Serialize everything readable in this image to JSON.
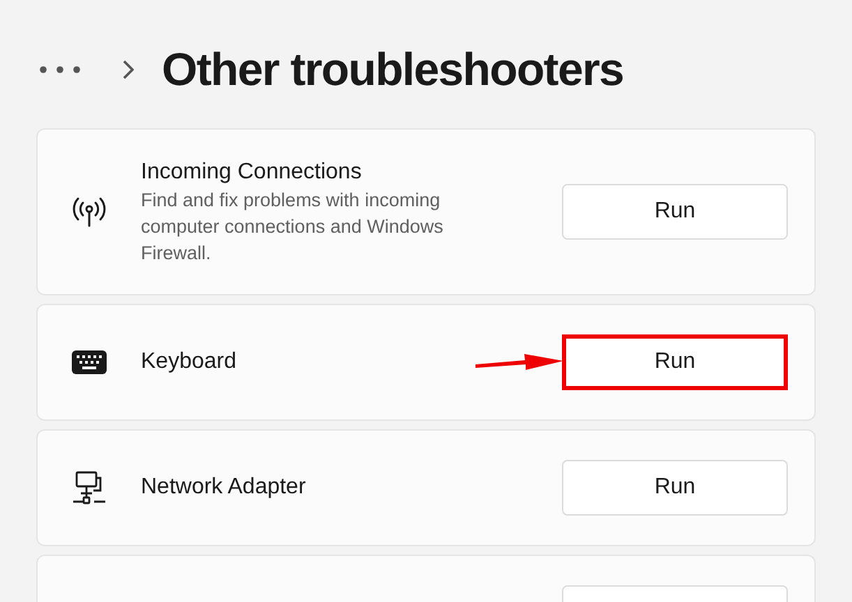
{
  "breadcrumb": {
    "title": "Other troubleshooters"
  },
  "items": [
    {
      "kind": "antenna",
      "name": "Incoming Connections",
      "description": "Find and fix problems with incoming computer connections and Windows Firewall.",
      "button": "Run",
      "highlighted": false
    },
    {
      "kind": "keyboard",
      "name": "Keyboard",
      "button": "Run",
      "highlighted": true
    },
    {
      "kind": "network",
      "name": "Network Adapter",
      "button": "Run",
      "highlighted": false
    }
  ],
  "more_below": true
}
